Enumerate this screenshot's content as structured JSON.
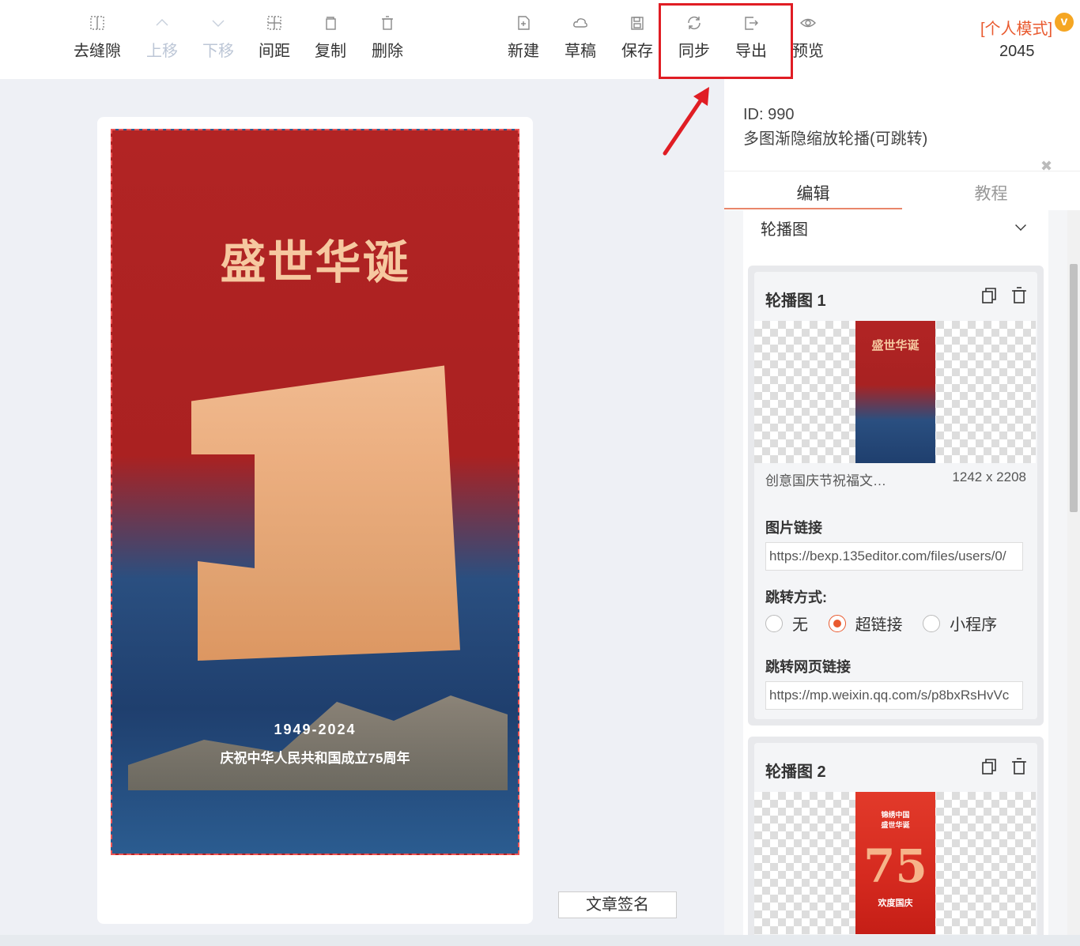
{
  "toolbar": {
    "left_tools": [
      {
        "label": "去缝隙",
        "icon": "gap-icon",
        "disabled": false
      },
      {
        "label": "上移",
        "icon": "chevron-up-icon",
        "disabled": true
      },
      {
        "label": "下移",
        "icon": "chevron-down-icon",
        "disabled": true
      },
      {
        "label": "间距",
        "icon": "spacing-icon",
        "disabled": false
      },
      {
        "label": "复制",
        "icon": "copy-icon",
        "disabled": false
      },
      {
        "label": "删除",
        "icon": "trash-icon",
        "disabled": false
      }
    ],
    "right_tools": [
      {
        "label": "新建",
        "icon": "new-file-icon"
      },
      {
        "label": "草稿",
        "icon": "cloud-icon"
      },
      {
        "label": "保存",
        "icon": "save-icon"
      },
      {
        "label": "同步",
        "icon": "sync-icon"
      },
      {
        "label": "导出",
        "icon": "export-icon"
      },
      {
        "label": "预览",
        "icon": "eye-icon"
      }
    ],
    "mode": "[个人模式]",
    "badge": "v",
    "count": "2045",
    "highlight_color": "#e01d24"
  },
  "poster": {
    "title": "盛世华诞",
    "years": "1949-2024",
    "slogan": "庆祝中华人民共和国成立75周年"
  },
  "sign_button": "文章签名",
  "panel": {
    "id_line": "ID: 990",
    "template_name": "多图渐隐缩放轮播(可跳转)",
    "tabs": [
      "编辑",
      "教程"
    ],
    "section_title": "轮播图",
    "items": [
      {
        "title": "轮播图 1",
        "thumb_text": "盛世华诞",
        "filename": "创意国庆节祝福文…",
        "dims": "1242 x 2208",
        "image_link_label": "图片链接",
        "image_link": "https://bexp.135editor.com/files/users/0/",
        "jump_label": "跳转方式:",
        "jump_options": [
          "无",
          "超链接",
          "小程序"
        ],
        "jump_selected": "超链接",
        "web_link_label": "跳转网页链接",
        "web_link": "https://mp.weixin.qq.com/s/p8bxRsHvVc"
      },
      {
        "title": "轮播图 2",
        "thumb_top": "锦绣中国\n盛世华诞",
        "thumb_mid": "75",
        "thumb_bottom": "欢度国庆"
      }
    ]
  },
  "colors": {
    "accent": "#e95a2f",
    "poster_red": "#b22424",
    "poster_blue": "#1f3f6e"
  }
}
